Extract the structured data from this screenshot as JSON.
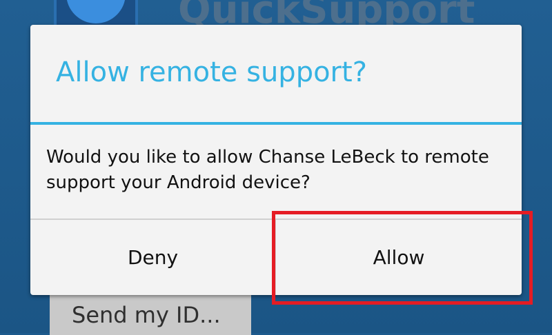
{
  "background_app": {
    "title": "QuickSupport",
    "send_id_label": "Send my ID..."
  },
  "dialog": {
    "title": "Allow remote support?",
    "message": "Would you like to allow Chanse LeBeck to remote support your Android device?",
    "deny_label": "Deny",
    "allow_label": "Allow"
  },
  "colors": {
    "accent": "#35b2e2",
    "highlight": "#e51c24",
    "background": "#1d5a8c"
  },
  "icons": {
    "app": "teamviewer-app-icon"
  }
}
